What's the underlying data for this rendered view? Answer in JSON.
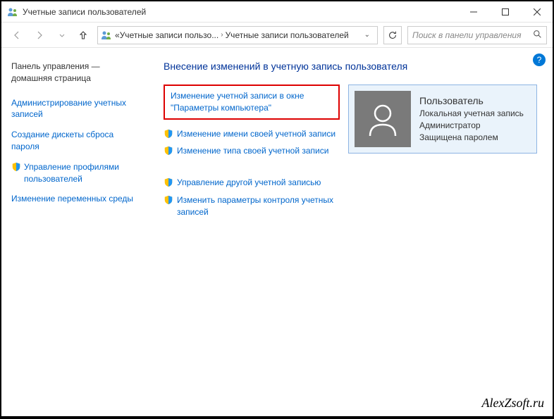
{
  "window": {
    "title": "Учетные записи пользователей"
  },
  "breadcrumb": {
    "prefix": "«",
    "item1": "Учетные записи пользо...",
    "item2": "Учетные записи пользователей"
  },
  "search": {
    "placeholder": "Поиск в панели управления"
  },
  "sidebar": {
    "home": "Панель управления — домашняя страница",
    "admin": "Администрирование учетных записей",
    "reset_disk": "Создание дискеты сброса пароля",
    "profiles": "Управление профилями пользователей",
    "env_vars": "Изменение переменных среды"
  },
  "main": {
    "heading": "Внесение изменений в учетную запись пользователя",
    "highlighted": "Изменение учетной записи в окне \"Параметры компьютера\"",
    "change_name": "Изменение имени своей учетной записи",
    "change_type": "Изменение типа своей учетной записи",
    "manage_other": "Управление другой учетной записью",
    "uac_settings": "Изменить параметры контроля учетных записей"
  },
  "user": {
    "name": "Пользователь",
    "type": "Локальная учетная запись",
    "role": "Администратор",
    "protected": "Защищена паролем"
  },
  "watermark": "AlexZsoft.ru"
}
